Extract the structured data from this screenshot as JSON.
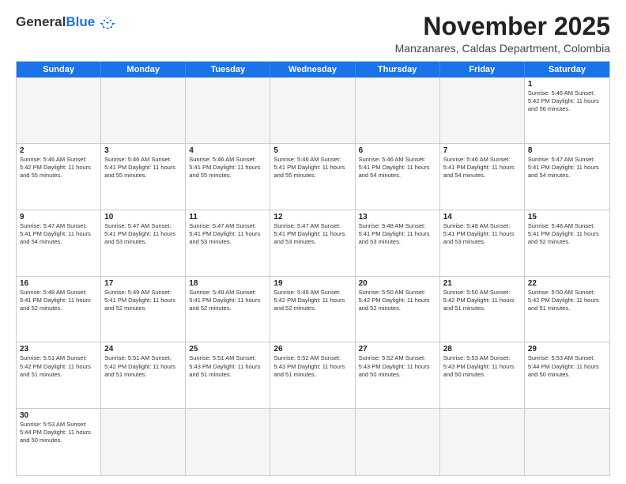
{
  "header": {
    "logo_general": "General",
    "logo_blue": "Blue",
    "month_title": "November 2025",
    "location": "Manzanares, Caldas Department, Colombia"
  },
  "weekdays": [
    "Sunday",
    "Monday",
    "Tuesday",
    "Wednesday",
    "Thursday",
    "Friday",
    "Saturday"
  ],
  "rows": [
    [
      {
        "day": "",
        "info": ""
      },
      {
        "day": "",
        "info": ""
      },
      {
        "day": "",
        "info": ""
      },
      {
        "day": "",
        "info": ""
      },
      {
        "day": "",
        "info": ""
      },
      {
        "day": "",
        "info": ""
      },
      {
        "day": "1",
        "info": "Sunrise: 5:46 AM\nSunset: 5:42 PM\nDaylight: 11 hours\nand 56 minutes."
      }
    ],
    [
      {
        "day": "2",
        "info": "Sunrise: 5:46 AM\nSunset: 5:42 PM\nDaylight: 11 hours\nand 55 minutes."
      },
      {
        "day": "3",
        "info": "Sunrise: 5:46 AM\nSunset: 5:41 PM\nDaylight: 11 hours\nand 55 minutes."
      },
      {
        "day": "4",
        "info": "Sunrise: 5:46 AM\nSunset: 5:41 PM\nDaylight: 11 hours\nand 55 minutes."
      },
      {
        "day": "5",
        "info": "Sunrise: 5:46 AM\nSunset: 5:41 PM\nDaylight: 11 hours\nand 55 minutes."
      },
      {
        "day": "6",
        "info": "Sunrise: 5:46 AM\nSunset: 5:41 PM\nDaylight: 11 hours\nand 54 minutes."
      },
      {
        "day": "7",
        "info": "Sunrise: 5:46 AM\nSunset: 5:41 PM\nDaylight: 11 hours\nand 54 minutes."
      },
      {
        "day": "8",
        "info": "Sunrise: 5:47 AM\nSunset: 5:41 PM\nDaylight: 11 hours\nand 54 minutes."
      }
    ],
    [
      {
        "day": "9",
        "info": "Sunrise: 5:47 AM\nSunset: 5:41 PM\nDaylight: 11 hours\nand 54 minutes."
      },
      {
        "day": "10",
        "info": "Sunrise: 5:47 AM\nSunset: 5:41 PM\nDaylight: 11 hours\nand 53 minutes."
      },
      {
        "day": "11",
        "info": "Sunrise: 5:47 AM\nSunset: 5:41 PM\nDaylight: 11 hours\nand 53 minutes."
      },
      {
        "day": "12",
        "info": "Sunrise: 5:47 AM\nSunset: 5:41 PM\nDaylight: 11 hours\nand 53 minutes."
      },
      {
        "day": "13",
        "info": "Sunrise: 5:48 AM\nSunset: 5:41 PM\nDaylight: 11 hours\nand 53 minutes."
      },
      {
        "day": "14",
        "info": "Sunrise: 5:48 AM\nSunset: 5:41 PM\nDaylight: 11 hours\nand 53 minutes."
      },
      {
        "day": "15",
        "info": "Sunrise: 5:48 AM\nSunset: 5:41 PM\nDaylight: 11 hours\nand 52 minutes."
      }
    ],
    [
      {
        "day": "16",
        "info": "Sunrise: 5:48 AM\nSunset: 5:41 PM\nDaylight: 11 hours\nand 52 minutes."
      },
      {
        "day": "17",
        "info": "Sunrise: 5:49 AM\nSunset: 5:41 PM\nDaylight: 11 hours\nand 52 minutes."
      },
      {
        "day": "18",
        "info": "Sunrise: 5:49 AM\nSunset: 5:41 PM\nDaylight: 11 hours\nand 52 minutes."
      },
      {
        "day": "19",
        "info": "Sunrise: 5:49 AM\nSunset: 5:42 PM\nDaylight: 11 hours\nand 52 minutes."
      },
      {
        "day": "20",
        "info": "Sunrise: 5:50 AM\nSunset: 5:42 PM\nDaylight: 11 hours\nand 52 minutes."
      },
      {
        "day": "21",
        "info": "Sunrise: 5:50 AM\nSunset: 5:42 PM\nDaylight: 11 hours\nand 51 minutes."
      },
      {
        "day": "22",
        "info": "Sunrise: 5:50 AM\nSunset: 5:42 PM\nDaylight: 11 hours\nand 51 minutes."
      }
    ],
    [
      {
        "day": "23",
        "info": "Sunrise: 5:51 AM\nSunset: 5:42 PM\nDaylight: 11 hours\nand 51 minutes."
      },
      {
        "day": "24",
        "info": "Sunrise: 5:51 AM\nSunset: 5:42 PM\nDaylight: 11 hours\nand 51 minutes."
      },
      {
        "day": "25",
        "info": "Sunrise: 5:51 AM\nSunset: 5:43 PM\nDaylight: 11 hours\nand 51 minutes."
      },
      {
        "day": "26",
        "info": "Sunrise: 5:52 AM\nSunset: 5:43 PM\nDaylight: 11 hours\nand 51 minutes."
      },
      {
        "day": "27",
        "info": "Sunrise: 5:52 AM\nSunset: 5:43 PM\nDaylight: 11 hours\nand 50 minutes."
      },
      {
        "day": "28",
        "info": "Sunrise: 5:53 AM\nSunset: 5:43 PM\nDaylight: 11 hours\nand 50 minutes."
      },
      {
        "day": "29",
        "info": "Sunrise: 5:53 AM\nSunset: 5:44 PM\nDaylight: 11 hours\nand 50 minutes."
      }
    ],
    [
      {
        "day": "30",
        "info": "Sunrise: 5:53 AM\nSunset: 5:44 PM\nDaylight: 11 hours\nand 50 minutes."
      },
      {
        "day": "",
        "info": ""
      },
      {
        "day": "",
        "info": ""
      },
      {
        "day": "",
        "info": ""
      },
      {
        "day": "",
        "info": ""
      },
      {
        "day": "",
        "info": ""
      },
      {
        "day": "",
        "info": ""
      }
    ]
  ]
}
